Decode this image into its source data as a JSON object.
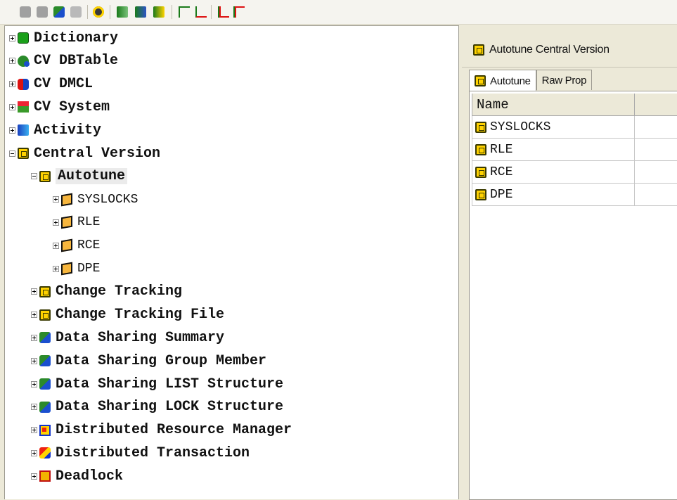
{
  "toolbar": {
    "buttons": [
      "disabled-button",
      "disabled-button",
      "connect-icon",
      "disconnect-icon",
      "refresh-icon",
      "copy-icon",
      "paste-icon",
      "report-icon",
      "tree-expand-icon",
      "tree-collapse-icon",
      "branch-icon",
      "leaf-icon"
    ]
  },
  "tree": {
    "nodes": [
      {
        "label": "Dictionary",
        "level": 0,
        "state": "plus",
        "icon": "dictionary-icon"
      },
      {
        "label": "CV DBTable",
        "level": 0,
        "state": "plus",
        "icon": "dbtable-icon"
      },
      {
        "label": "CV DMCL",
        "level": 0,
        "state": "plus",
        "icon": "dmcl-icon"
      },
      {
        "label": "CV System",
        "level": 0,
        "state": "plus",
        "icon": "system-icon"
      },
      {
        "label": "Activity",
        "level": 0,
        "state": "plus",
        "icon": "activity-icon"
      },
      {
        "label": "Central Version",
        "level": 0,
        "state": "minus",
        "icon": "central-version-icon"
      },
      {
        "label": "Autotune",
        "level": 1,
        "state": "minus",
        "icon": "autotune-icon",
        "selected": true
      },
      {
        "label": "SYSLOCKS",
        "level": 2,
        "state": "plus",
        "icon": "cube-icon",
        "plain": true
      },
      {
        "label": "RLE",
        "level": 2,
        "state": "plus",
        "icon": "cube-icon",
        "plain": true
      },
      {
        "label": "RCE",
        "level": 2,
        "state": "plus",
        "icon": "cube-icon",
        "plain": true
      },
      {
        "label": "DPE",
        "level": 2,
        "state": "plus",
        "icon": "cube-icon",
        "plain": true
      },
      {
        "label": "Change Tracking",
        "level": 1,
        "state": "plus",
        "icon": "change-tracking-icon"
      },
      {
        "label": "Change Tracking File",
        "level": 1,
        "state": "plus",
        "icon": "change-tracking-file-icon"
      },
      {
        "label": "Data Sharing Summary",
        "level": 1,
        "state": "plus",
        "icon": "data-sharing-icon"
      },
      {
        "label": "Data Sharing Group Member",
        "level": 1,
        "state": "plus",
        "icon": "data-sharing-icon"
      },
      {
        "label": "Data Sharing LIST Structure",
        "level": 1,
        "state": "plus",
        "icon": "data-sharing-icon"
      },
      {
        "label": "Data Sharing LOCK Structure",
        "level": 1,
        "state": "plus",
        "icon": "data-sharing-icon"
      },
      {
        "label": "Distributed Resource Manager",
        "level": 1,
        "state": "plus",
        "icon": "distributed-resource-icon"
      },
      {
        "label": "Distributed Transaction",
        "level": 1,
        "state": "plus",
        "icon": "distributed-transaction-icon"
      },
      {
        "label": "Deadlock",
        "level": 1,
        "state": "plus",
        "icon": "deadlock-icon"
      }
    ]
  },
  "right_panel": {
    "title": "Autotune  Central Version",
    "tabs": [
      {
        "label": "Autotune",
        "active": true
      },
      {
        "label": "Raw Prop",
        "active": false
      }
    ],
    "grid": {
      "column_header": "Name",
      "rows": [
        "SYSLOCKS",
        "RLE",
        "RCE",
        "DPE"
      ]
    }
  }
}
